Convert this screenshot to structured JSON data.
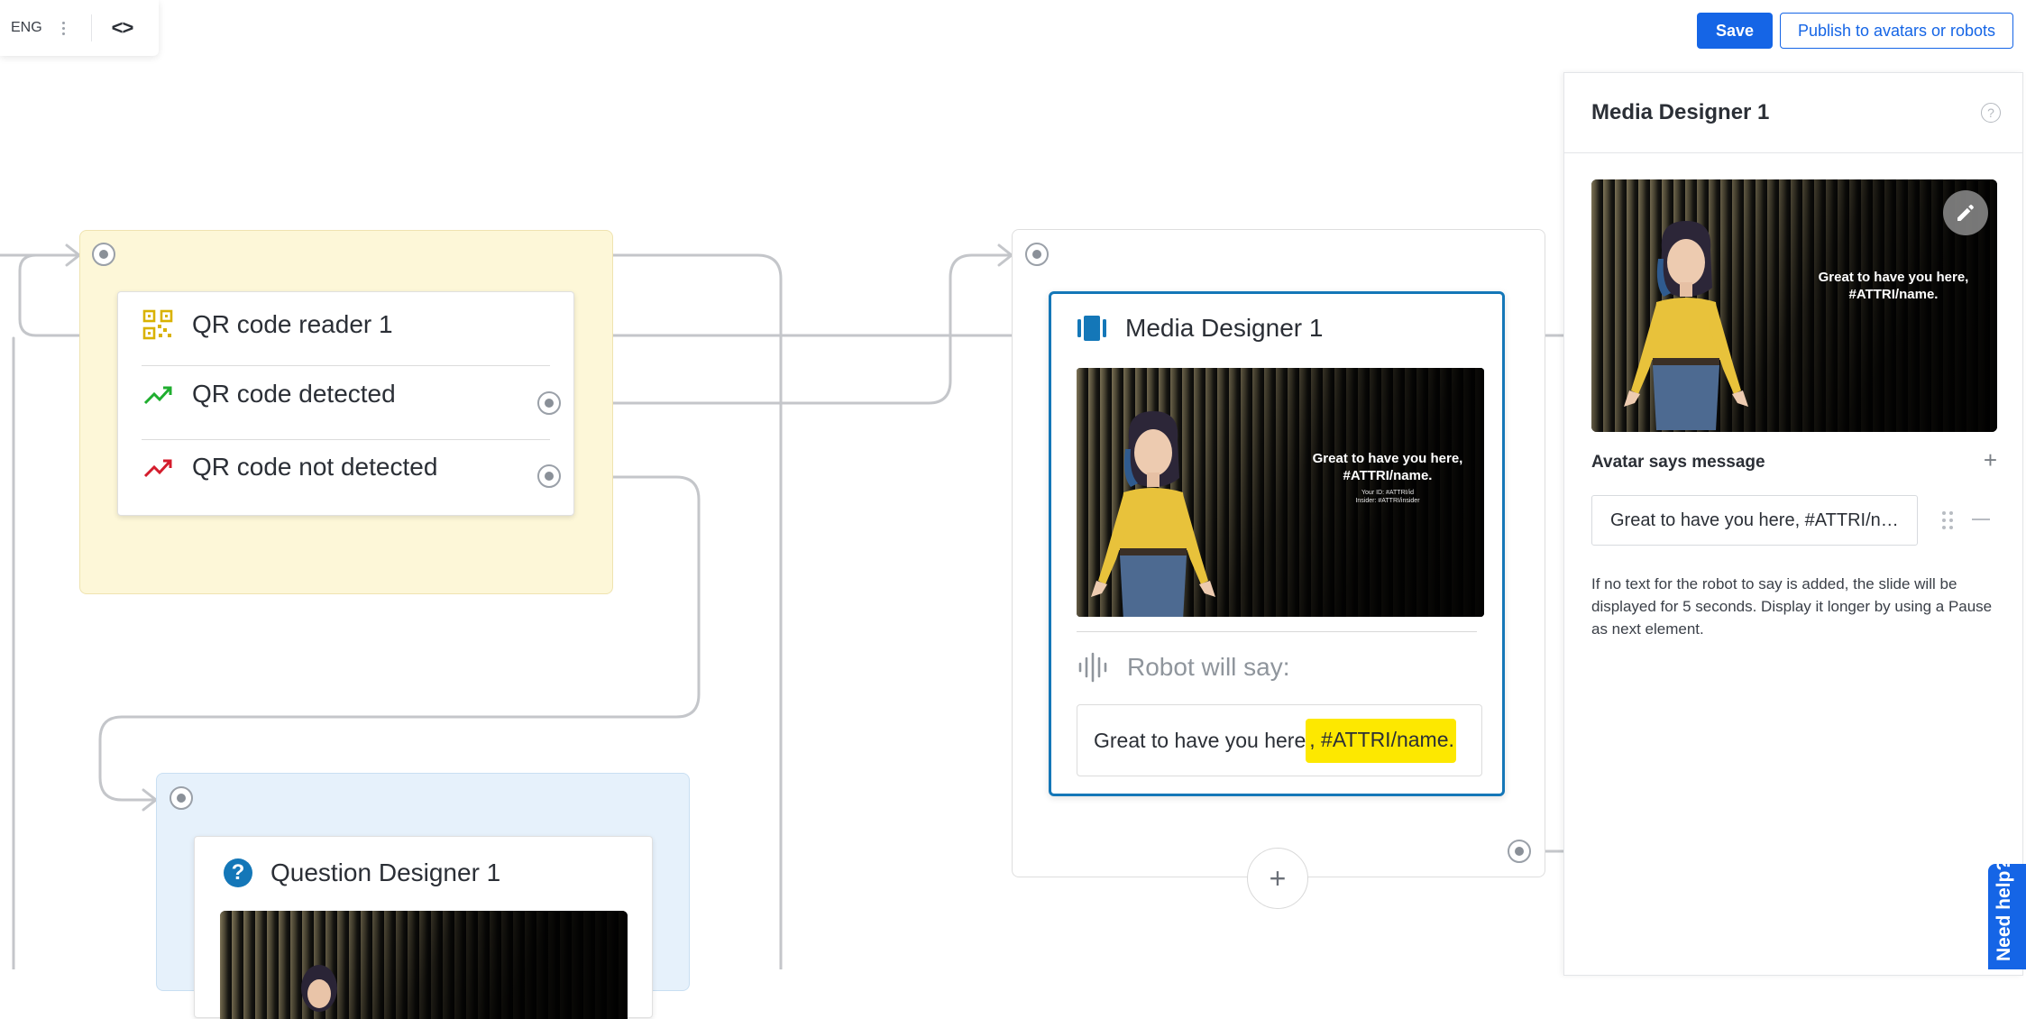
{
  "toolbar": {
    "language": "ENG",
    "save_label": "Save",
    "publish_label": "Publish to avatars or robots"
  },
  "qr_node": {
    "title": "QR code reader 1",
    "outputs": [
      {
        "label": "QR code detected",
        "icon": "trend-up-icon",
        "color": "#1fae2f"
      },
      {
        "label": "QR code not detected",
        "icon": "trend-down-icon",
        "color": "#d41c2c"
      }
    ],
    "icon": "qr-code-icon",
    "accent": "#d9b200"
  },
  "question_node": {
    "title": "Question Designer 1",
    "icon": "question-circle-icon"
  },
  "media_node": {
    "title": "Media Designer 1",
    "icon": "media-slides-icon",
    "preview": {
      "headline_line1": "Great to have you here,",
      "headline_line2": "#ATTRI/name.",
      "small_line1": "Your ID: #ATTRI/id",
      "small_line2": "Insider: #ATTRI/insider"
    },
    "robot_say_label": "Robot will say:",
    "robot_say_text": "Great to have you here",
    "robot_say_highlight": ", #ATTRI/name."
  },
  "panel": {
    "title": "Media Designer 1",
    "preview_line1": "Great to have you here,",
    "preview_line2": "#ATTRI/name.",
    "section_label": "Avatar says message",
    "message_value": "Great to have you here, #ATTRI/name.",
    "note": "If no text for the robot to say is added, the slide will be displayed for 5 seconds. Display it longer by using a Pause as next element."
  },
  "help": {
    "label": "Need help?"
  },
  "colors": {
    "primary": "#1565e6",
    "node_border": "#1477b8",
    "highlight": "#fde800"
  }
}
